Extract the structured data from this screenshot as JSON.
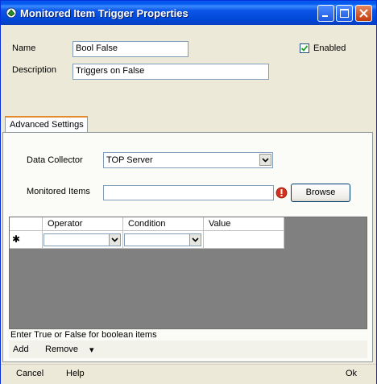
{
  "window": {
    "title": "Monitored Item Trigger Properties",
    "accent": "#0058ee",
    "icons": [
      "app-icon",
      "minimize-icon",
      "maximize-icon",
      "close-icon"
    ]
  },
  "form": {
    "name_label": "Name",
    "name_value": "Bool False",
    "description_label": "Description",
    "description_value": "Triggers on False",
    "enabled_label": "Enabled",
    "enabled_checked": true
  },
  "tabs": [
    {
      "label": "Advanced Settings",
      "active": true
    }
  ],
  "advanced": {
    "data_collector_label": "Data Collector",
    "data_collector_value": "TOP Server",
    "monitored_items_label": "Monitored Items",
    "monitored_items_value": "",
    "error_icon": "error-icon",
    "browse_label": "Browse"
  },
  "grid": {
    "columns": [
      "Operator",
      "Condition",
      "Value"
    ],
    "new_row_marker": "✱",
    "rows": [
      {
        "operator": "",
        "condition": "",
        "value": ""
      }
    ]
  },
  "hint_text": "Enter True or False for boolean items",
  "toolbar": {
    "add_label": "Add",
    "remove_label": "Remove",
    "remove_dropdown": "▾"
  },
  "footer": {
    "cancel_label": "Cancel",
    "help_label": "Help",
    "ok_label": "Ok"
  }
}
